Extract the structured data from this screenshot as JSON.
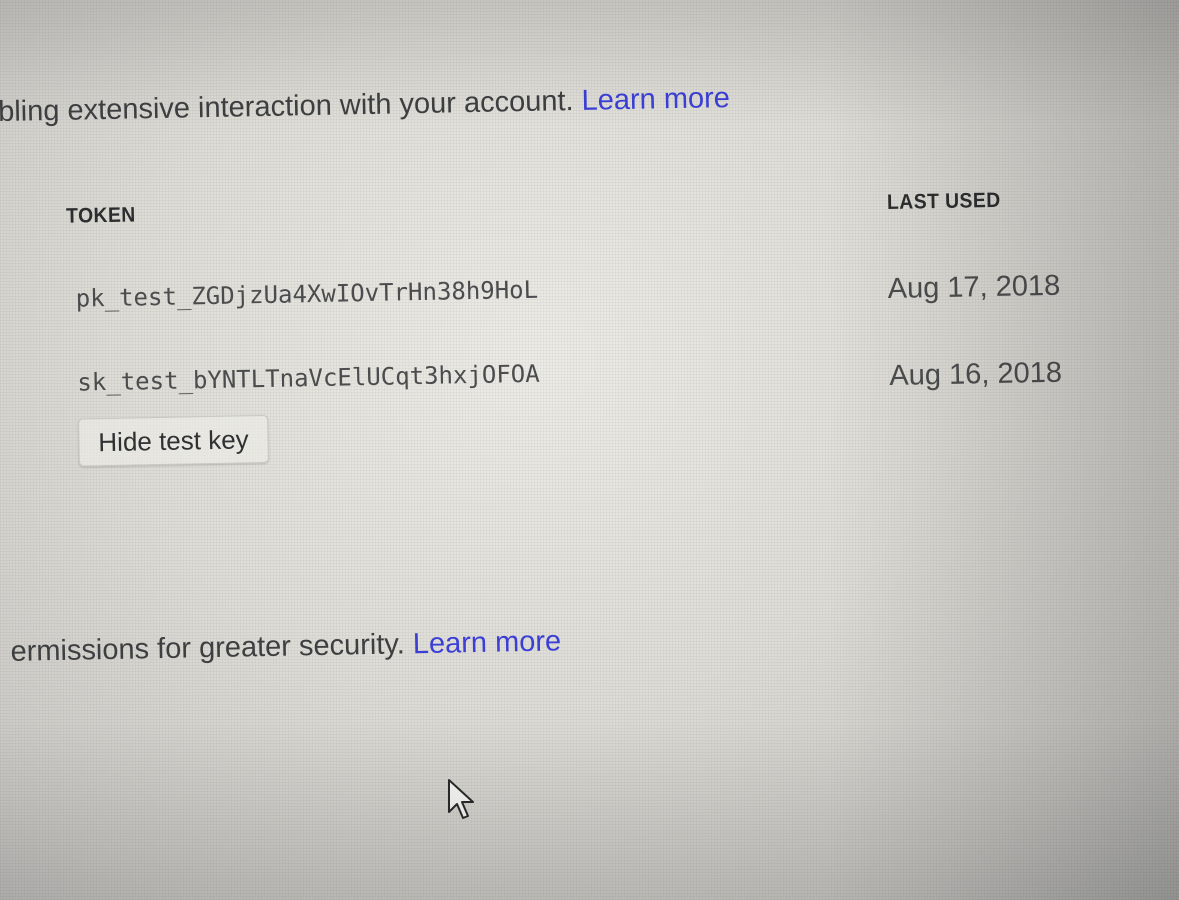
{
  "intro": {
    "text": "bling extensive interaction with your account. ",
    "link": "Learn more"
  },
  "table": {
    "headers": {
      "token": "TOKEN",
      "last_used": "LAST USED"
    },
    "rows": [
      {
        "token": "pk_test_ZGDjzUa4XwIOvTrHn38h9HoL",
        "last_used": "Aug 17, 2018"
      },
      {
        "token": "sk_test_bYNTLTnaVcElUCqt3hxjOFOA",
        "last_used": "Aug 16, 2018"
      }
    ]
  },
  "hide_button": "Hide test key",
  "restricted": {
    "text": "ermissions for greater security. ",
    "link": "Learn more"
  },
  "colors": {
    "link": "#3b3fd6",
    "text": "#3d3f40"
  },
  "icons": {
    "cursor": "mouse-pointer-icon"
  }
}
